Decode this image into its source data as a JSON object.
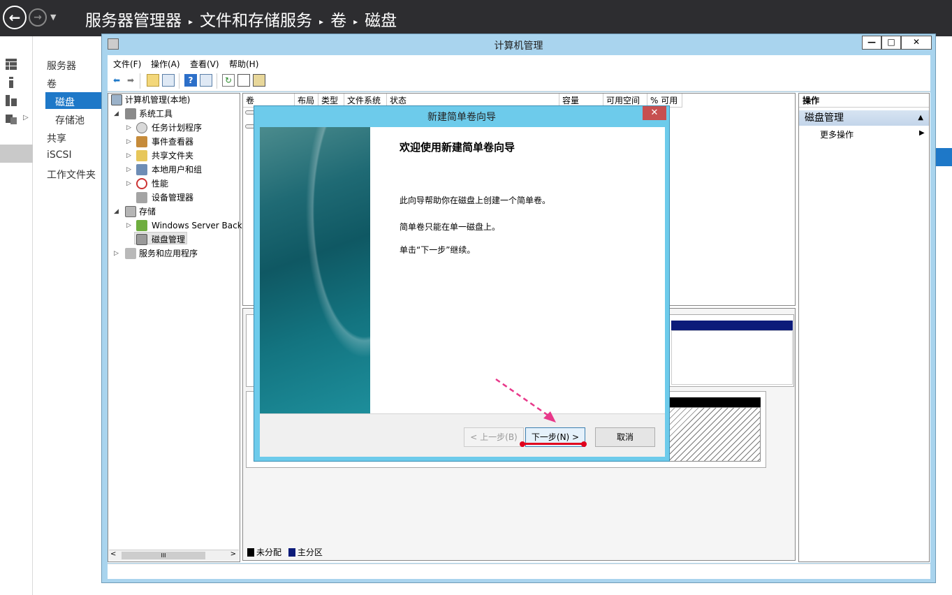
{
  "server_manager": {
    "breadcrumb": [
      "服务器管理器",
      "文件和存储服务",
      "卷",
      "磁盘"
    ],
    "nav": {
      "servers": "服务器",
      "volumes": "卷",
      "disks": "磁盘",
      "storage_pools": "存储池",
      "shares": "共享",
      "iscsi": "iSCSI",
      "work_folders": "工作文件夹"
    }
  },
  "cm_window": {
    "title": "计算机管理",
    "menu": [
      "文件(F)",
      "操作(A)",
      "查看(V)",
      "帮助(H)"
    ],
    "tree": {
      "root": "计算机管理(本地)",
      "system_tools": "系统工具",
      "task_scheduler": "任务计划程序",
      "event_viewer": "事件查看器",
      "shared_folders": "共享文件夹",
      "local_users": "本地用户和组",
      "performance": "性能",
      "device_manager": "设备管理器",
      "storage": "存储",
      "windows_backup": "Windows Server Back",
      "disk_management": "磁盘管理",
      "services_apps": "服务和应用程序"
    },
    "columns": [
      "卷",
      "布局",
      "类型",
      "文件系统",
      "状态",
      "容量",
      "可用空间",
      "% 可用"
    ],
    "legend": {
      "unallocated": "未分配",
      "primary": "主分区"
    },
    "actions": {
      "header": "操作",
      "section": "磁盘管理",
      "more": "更多操作"
    }
  },
  "wizard": {
    "title": "新建简单卷向导",
    "heading": "欢迎使用新建简单卷向导",
    "line1": "此向导帮助你在磁盘上创建一个简单卷。",
    "line2": "简单卷只能在单一磁盘上。",
    "line3": "单击“下一步”继续。",
    "back_button": "< 上一步(B)",
    "next_button": "下一步(N) >",
    "cancel_button": "取消"
  },
  "colors": {
    "accent": "#1e78c8",
    "highlight": "#e1001d",
    "arrow": "#e8388a"
  }
}
